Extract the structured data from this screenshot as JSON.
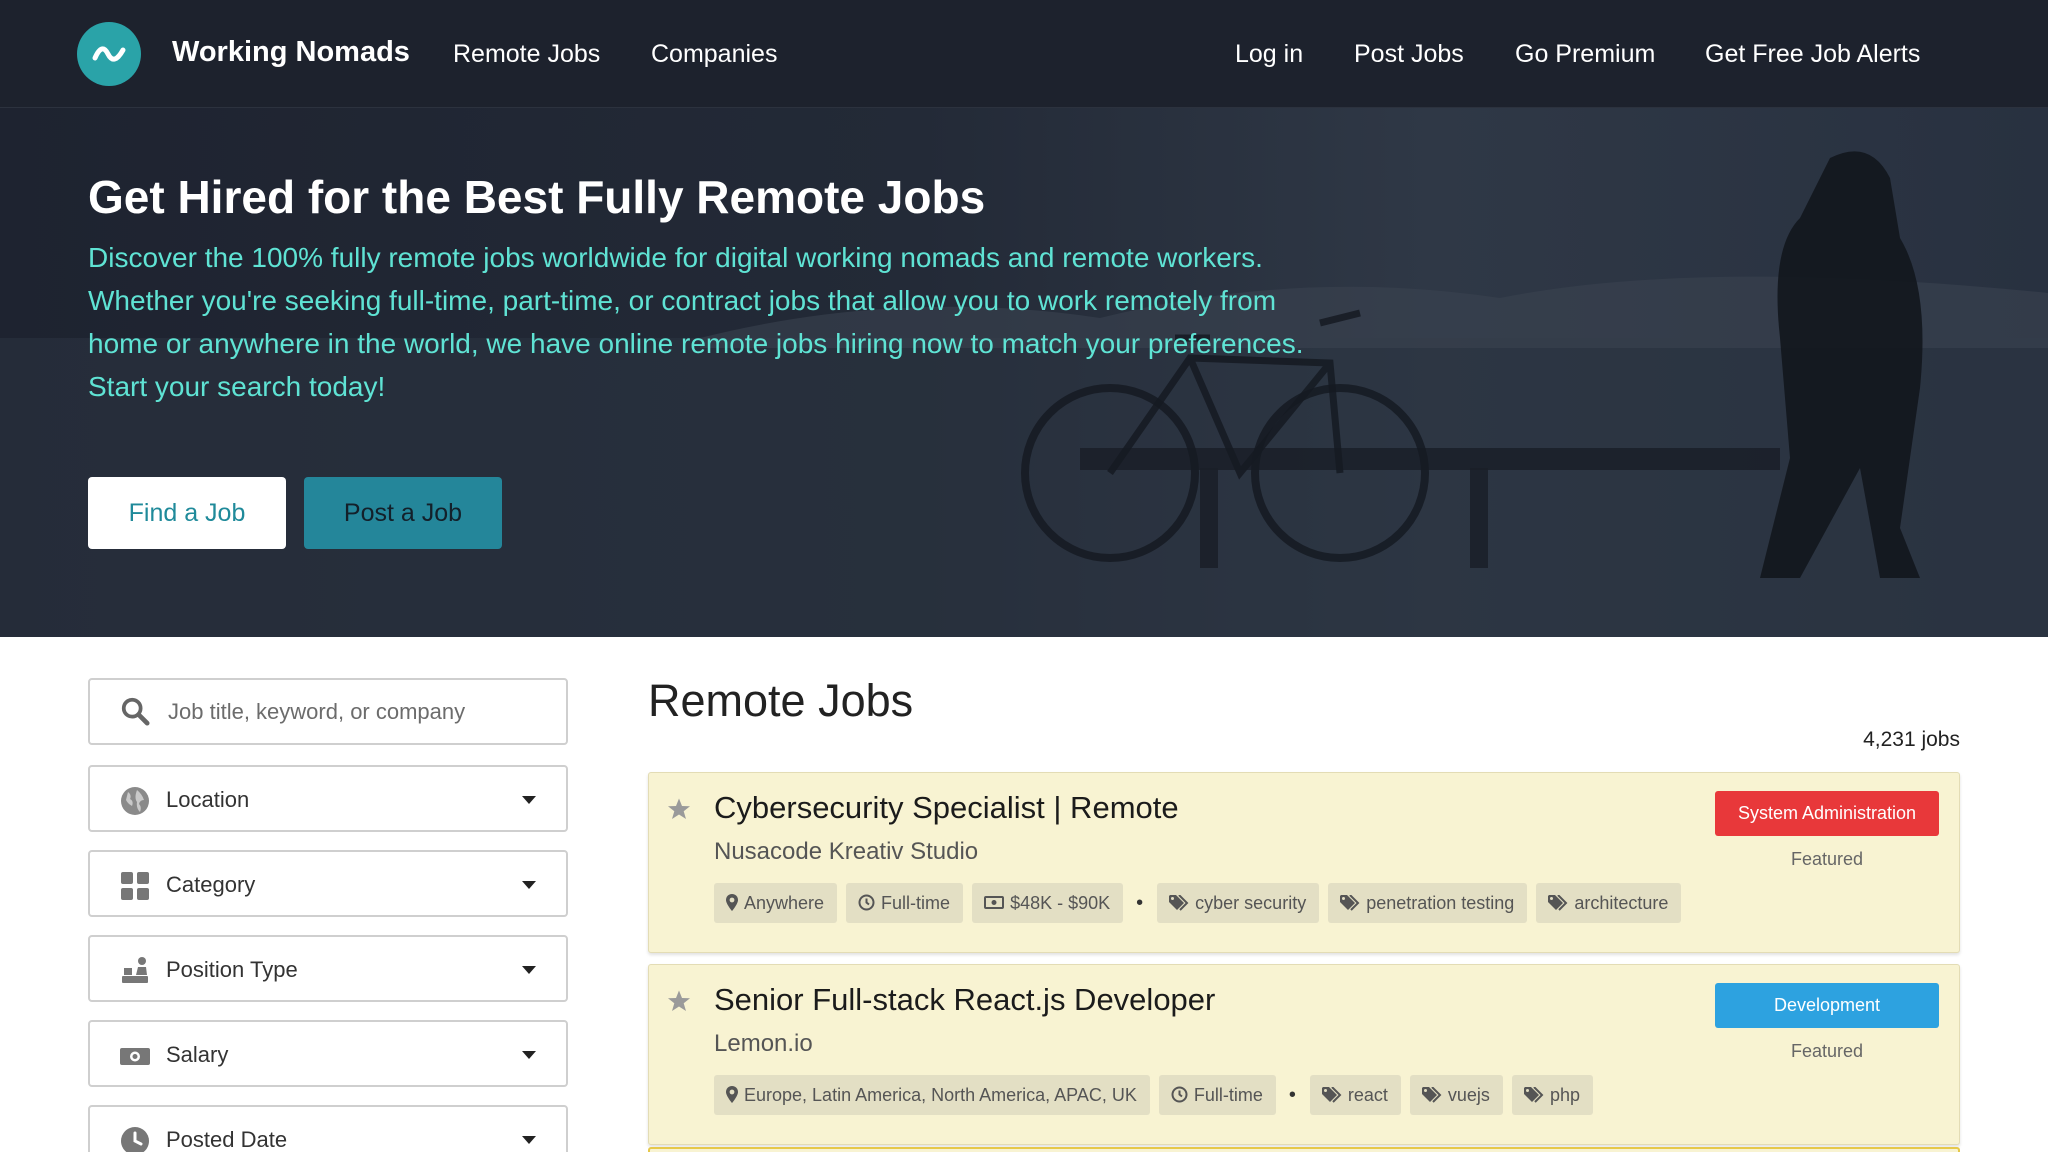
{
  "nav": {
    "brand": "Working Nomads",
    "left_links": [
      "Remote Jobs",
      "Companies"
    ],
    "right_links": [
      "Log in",
      "Post Jobs",
      "Go Premium",
      "Get Free Job Alerts"
    ]
  },
  "hero": {
    "title": "Get Hired for the Best Fully Remote Jobs",
    "description": "Discover the 100% fully remote jobs worldwide for digital working nomads and remote workers. Whether you're seeking full-time, part-time, or contract jobs that allow you to work remotely from home or anywhere in the world, we have online remote jobs hiring now to match your preferences. Start your search today!",
    "find_button": "Find a Job",
    "post_button": "Post a Job"
  },
  "filters": {
    "search_placeholder": "Job title, keyword, or company",
    "location": "Location",
    "category": "Category",
    "position_type": "Position Type",
    "salary": "Salary",
    "posted_date": "Posted Date"
  },
  "main": {
    "title": "Remote Jobs",
    "job_count": "4,231 jobs"
  },
  "jobs": [
    {
      "title": "Cybersecurity Specialist | Remote",
      "company": "Nusacode Kreativ Studio",
      "category": "System Administration",
      "category_color": "#e8383a",
      "featured": "Featured",
      "location": "Anywhere",
      "type": "Full-time",
      "salary": "$48K - $90K",
      "tags": [
        "cyber security",
        "penetration testing",
        "architecture"
      ]
    },
    {
      "title": "Senior Full-stack React.js Developer",
      "company": "Lemon.io",
      "category": "Development",
      "category_color": "#2da2e0",
      "featured": "Featured",
      "location": "Europe, Latin America, North America, APAC, UK",
      "type": "Full-time",
      "tags": [
        "react",
        "vuejs",
        "php"
      ]
    }
  ],
  "colors": {
    "nav_bg": "#1d222d",
    "accent_teal": "#2aa3a8",
    "hero_text": "#5fe3d4",
    "card_bg": "#f8f3d2"
  },
  "icons": [
    "logo-wave-icon",
    "search-icon",
    "globe-icon",
    "grid-icon",
    "worker-icon",
    "money-icon",
    "clock-icon",
    "star-icon",
    "map-pin-icon",
    "tag-icon"
  ]
}
